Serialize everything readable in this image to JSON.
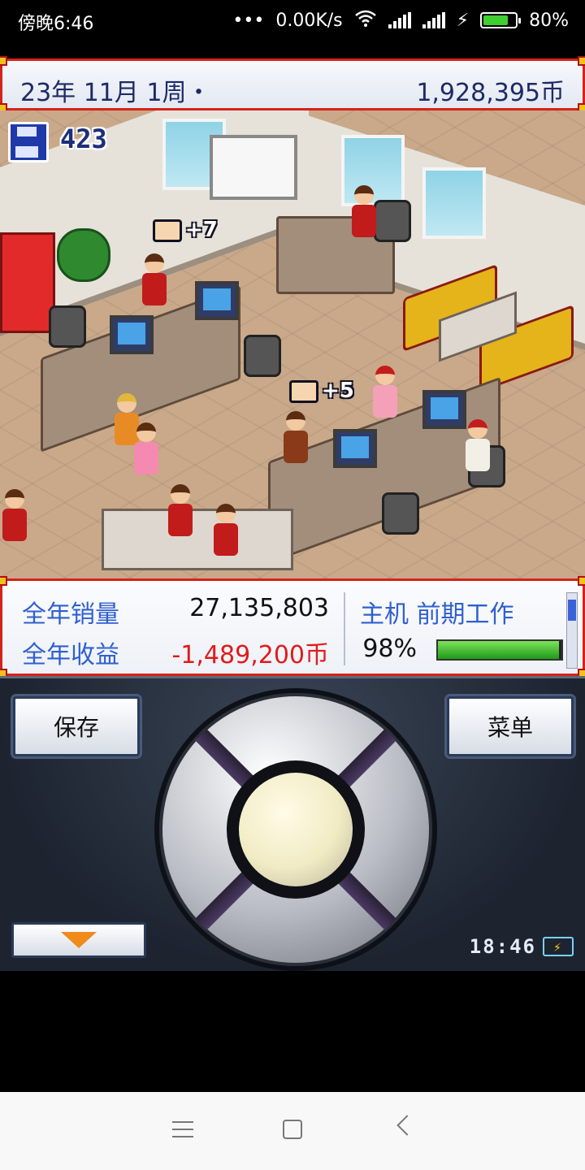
{
  "status_bar": {
    "time": "傍晚6:46",
    "network_speed": "0.00K/s",
    "battery_percent": "80%",
    "battery_level": 0.8,
    "icons": [
      "dots-icon",
      "wifi-icon",
      "signal-icon",
      "signal-icon",
      "charging-icon",
      "battery-icon"
    ]
  },
  "top_bar": {
    "date": "23年 11月 1周・",
    "money": "1,928,395币"
  },
  "scene": {
    "research_points": "423",
    "bubbles": [
      {
        "text": "+7"
      },
      {
        "text": "+5"
      }
    ]
  },
  "stats": {
    "annual_sales_label": "全年销量",
    "annual_sales_value": "27,135,803",
    "annual_income_label": "全年收益",
    "annual_income_value": "-1,489,200币",
    "project_label": "主机 前期工作",
    "progress_text": "98%",
    "progress_value": 0.98
  },
  "controls": {
    "save_label": "保存",
    "menu_label": "菜单",
    "clock": "18:46"
  },
  "colors": {
    "frame_red": "#d4231a",
    "text_blue": "#2f5fd0",
    "negative_red": "#e01b1b",
    "progress_green": "#3fb52a"
  }
}
